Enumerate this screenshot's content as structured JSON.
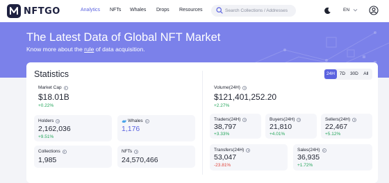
{
  "brand": {
    "name": "NFTGO"
  },
  "nav": {
    "items": [
      {
        "label": "Analytics",
        "active": true
      },
      {
        "label": "NFTs",
        "active": false
      },
      {
        "label": "Whales",
        "active": false
      },
      {
        "label": "Drops",
        "active": false
      },
      {
        "label": "Resources",
        "active": false
      }
    ]
  },
  "search": {
    "placeholder": "Search Collections / Addresses"
  },
  "language": "EN",
  "icons": {
    "search": "search-icon",
    "theme": "moon-icon",
    "language_dropdown": "chevron-down-icon",
    "account": "user-icon",
    "whales": "whale-icon",
    "info": "info-icon"
  },
  "banner": {
    "title": "The Latest Data of Global NFT Market",
    "subtitle_before": "Know more about the ",
    "subtitle_link": "rule",
    "subtitle_after": " of data acquisition."
  },
  "stats": {
    "title": "Statistics",
    "ranges": [
      "24H",
      "7D",
      "30D",
      "All"
    ],
    "selected_range": "24H",
    "market_cap": {
      "label": "Market Cap",
      "value": "$18.01B",
      "change": "+0.22%"
    },
    "holders": {
      "label": "Holders",
      "value": "2,162,036",
      "change": "+9.51%"
    },
    "whales": {
      "label": "Whales",
      "value": "1,176"
    },
    "collections": {
      "label": "Collections",
      "value": "1,985"
    },
    "nfts": {
      "label": "NFTs",
      "value": "24,570,466"
    },
    "volume": {
      "label": "Volume(24H)",
      "value": "$121,401,252.20",
      "change": "+2.27%"
    },
    "traders": {
      "label": "Traders(24H)",
      "value": "38,797",
      "change": "+3.33%"
    },
    "buyers": {
      "label": "Buyers(24H)",
      "value": "21,810",
      "change": "+4.01%"
    },
    "sellers": {
      "label": "Sellers(24H)",
      "value": "22,467",
      "change": "+5.12%"
    },
    "transfers": {
      "label": "Transfers(24H)",
      "value": "53,047",
      "change": "-23.81%"
    },
    "sales": {
      "label": "Sales(24H)",
      "value": "36,935",
      "change": "+1.72%"
    }
  },
  "colors": {
    "accent": "#5b63e0",
    "banner": "#7b81ea",
    "positive": "#23a55a",
    "negative": "#e0453c"
  }
}
